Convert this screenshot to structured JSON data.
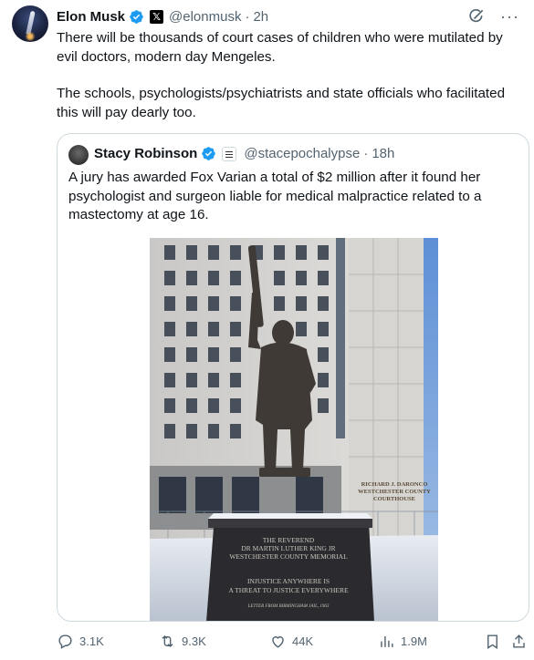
{
  "tweet": {
    "author_name": "Elon Musk",
    "handle": "@elonmusk",
    "separator": "·",
    "time": "2h",
    "paragraphs": [
      "There will be thousands of court cases of children who were mutilated by evil doctors, modern day Mengeles.",
      "The schools, psychologists/psychiatrists and state officials who facilitated this will pay dearly too."
    ]
  },
  "quote": {
    "author_name": "Stacy Robinson",
    "handle": "@stacepochalypse",
    "separator": "·",
    "time": "18h",
    "text": "A jury has awarded Fox Varian a total of $2 million after it found her psychologist and surgeon liable for medical malpractice related to a mastectomy at age 16.",
    "image": {
      "building_sign": [
        "RICHARD J. DARONCO",
        "WESTCHESTER COUNTY",
        "COURTHOUSE"
      ],
      "plaque_top": [
        "THE REVEREND",
        "DR MARTIN LUTHER KING JR",
        "WESTCHESTER COUNTY MEMORIAL"
      ],
      "plaque_quote": [
        "INJUSTICE ANYWHERE IS",
        "A THREAT TO JUSTICE EVERYWHERE"
      ],
      "plaque_source": "LETTER FROM BIRMINGHAM JAIL, 1963"
    }
  },
  "actions": {
    "replies": "3.1K",
    "reposts": "9.3K",
    "likes": "44K",
    "views": "1.9M"
  },
  "colors": {
    "verified_blue": "#1d9bf0",
    "muted_text": "#536471",
    "border": "#cfd9de"
  },
  "icons": [
    "grok-icon",
    "more-icon",
    "verified-icon",
    "x-affiliate-icon",
    "reply-icon",
    "repost-icon",
    "like-icon",
    "views-icon",
    "bookmark-icon",
    "share-icon"
  ]
}
